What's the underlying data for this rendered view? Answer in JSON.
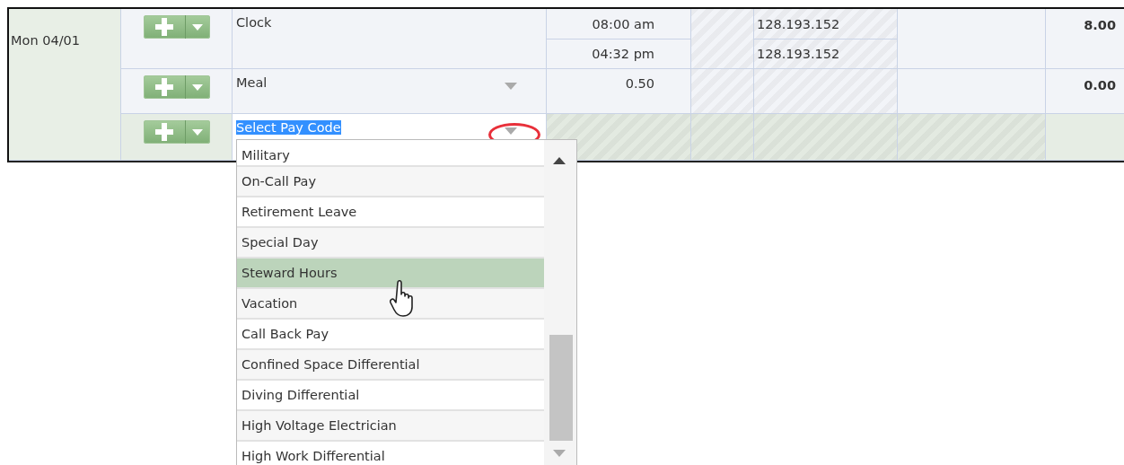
{
  "day": "Mon 04/01",
  "entries": [
    {
      "kind": "clock",
      "pay_code": "Clock",
      "times": [
        "08:00 am",
        "04:32 pm"
      ],
      "ips": [
        "128.193.152",
        "128.193.152"
      ],
      "total": "8.00"
    },
    {
      "kind": "amount",
      "pay_code": "Meal",
      "amount": "0.50",
      "total": "0.00"
    },
    {
      "kind": "new",
      "value": "Select Pay Code"
    }
  ],
  "dropdown": {
    "options": [
      {
        "label": "Military",
        "selected": false
      },
      {
        "label": "On-Call Pay",
        "selected": false
      },
      {
        "label": "Retirement Leave",
        "selected": false
      },
      {
        "label": "Special Day",
        "selected": false
      },
      {
        "label": "Steward Hours",
        "selected": true
      },
      {
        "label": "Vacation",
        "selected": false
      },
      {
        "label": "Call Back Pay",
        "selected": false
      },
      {
        "label": "Confined Space Differential",
        "selected": false
      },
      {
        "label": "Diving Differential",
        "selected": false
      },
      {
        "label": "High Voltage Electrician",
        "selected": false
      },
      {
        "label": "High Work Differential",
        "selected": false
      }
    ]
  }
}
